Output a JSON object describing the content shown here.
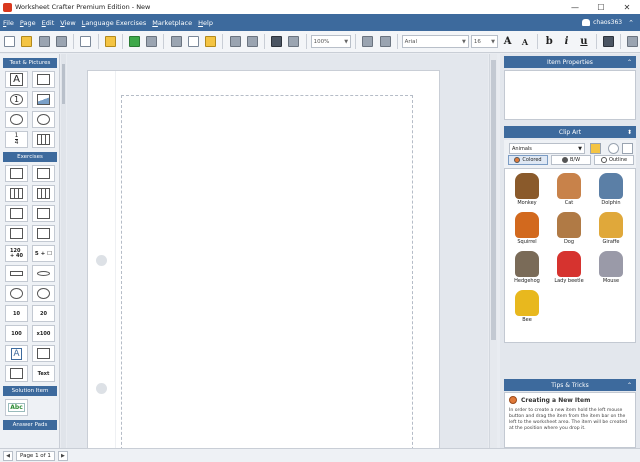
{
  "window": {
    "title": "Worksheet Crafter Premium Edition - New"
  },
  "menu": {
    "items": [
      {
        "label": "File",
        "access": "F"
      },
      {
        "label": "Page",
        "access": "P"
      },
      {
        "label": "Edit",
        "access": "E"
      },
      {
        "label": "View",
        "access": "V"
      },
      {
        "label": "Language Exercises",
        "access": "L"
      },
      {
        "label": "Marketplace",
        "access": "M"
      },
      {
        "label": "Help",
        "access": "H"
      }
    ],
    "user": "chaos363"
  },
  "toolbar": {
    "zoom": "100%",
    "font": "Arial",
    "font_size": "16",
    "grow_font": "A",
    "shrink_font": "A",
    "bold": "b",
    "italic": "i",
    "underline": "u"
  },
  "left_panel": {
    "sections": [
      {
        "header": "Text & Pictures"
      },
      {
        "header": "Exercises"
      },
      {
        "header": "Solution Item"
      },
      {
        "header": "Answer Pads"
      }
    ],
    "tiles": {
      "text": "A",
      "number": "1",
      "fraction_top": "1",
      "fraction_bottom": "4",
      "calc_a": "120",
      "calc_b": "+ 40",
      "calc_c": "5 + ☐",
      "num_10": "10",
      "num_20": "20",
      "num_100": "100",
      "num_x100": "x100",
      "text_tile": "Text",
      "solution": "Abc"
    }
  },
  "right_panel": {
    "item_properties": {
      "header": "Item Properties"
    },
    "clip_art": {
      "header": "Clip Art",
      "category": "Animals",
      "tabs": [
        {
          "label": "Colored",
          "active": true
        },
        {
          "label": "B/W",
          "active": false
        },
        {
          "label": "Outline",
          "active": false
        }
      ],
      "items": [
        {
          "name": "Monkey",
          "color": "#8a5a2b"
        },
        {
          "name": "Cat",
          "color": "#c8824a"
        },
        {
          "name": "Dolphin",
          "color": "#5b7fa6"
        },
        {
          "name": "Squirrel",
          "color": "#d2691e"
        },
        {
          "name": "Dog",
          "color": "#b07a45"
        },
        {
          "name": "Giraffe",
          "color": "#e0a83a"
        },
        {
          "name": "Hedgehog",
          "color": "#7a6b58"
        },
        {
          "name": "Lady beetle",
          "color": "#d6332f"
        },
        {
          "name": "Mouse",
          "color": "#9a9aa8"
        },
        {
          "name": "Bee",
          "color": "#e8b81e"
        }
      ]
    },
    "tips": {
      "header": "Tips & Tricks",
      "title": "Creating a New Item",
      "text": "In order to create a new item hold the left mouse button and drag the item from the item bar on the left to the worksheet area. The item will be created at the position where you drop it."
    }
  },
  "status": {
    "page": "Page 1 of 1"
  },
  "colors": {
    "accent": "#3d6a9d"
  },
  "icons": {
    "chevron-up": "⌃",
    "close": "✕",
    "maximize": "☐",
    "minimize": "—",
    "up-down": "⬍"
  }
}
